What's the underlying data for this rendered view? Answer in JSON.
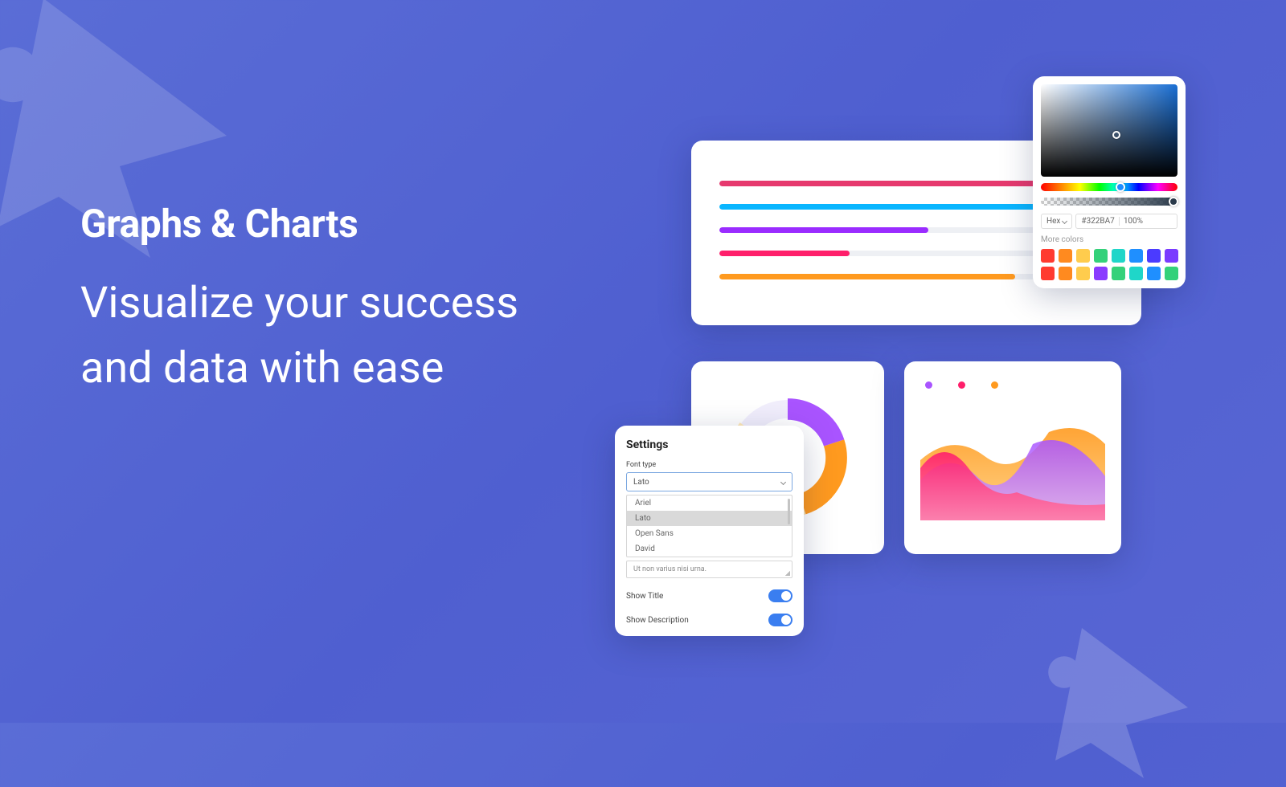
{
  "hero": {
    "title": "Graphs & Charts",
    "subtitle": "Visualize your success and data with ease"
  },
  "bars": [
    {
      "color": "#e6396e",
      "pct": 96
    },
    {
      "color": "#0ab6ff",
      "pct": 98
    },
    {
      "color": "#9a2cff",
      "pct": 53
    },
    {
      "color": "#ff1f6b",
      "pct": 33
    },
    {
      "color": "#ff9a1f",
      "pct": 75
    }
  ],
  "donut_colors": [
    "#a954ff",
    "#ffb81f",
    "#ffe9b8"
  ],
  "area_legend": [
    "#a954ff",
    "#ff1f6b",
    "#ff9a1f"
  ],
  "settings": {
    "title": "Settings",
    "font_label": "Font type",
    "font_selected": "Lato",
    "font_options": [
      "Ariel",
      "Lato",
      "Open Sans",
      "David"
    ],
    "textarea_value": "Ut non varius nisi urna.",
    "show_title_label": "Show Title",
    "show_desc_label": "Show Description",
    "show_title": true,
    "show_desc": true
  },
  "picker": {
    "mode": "Hex",
    "hex": "#322BA7",
    "alpha": "100%",
    "more_label": "More colors",
    "swatches": [
      "#ff3b30",
      "#ff8a1f",
      "#ffcc4d",
      "#34d17a",
      "#1fd6c9",
      "#1f8fff",
      "#4b3bff",
      "#7a3bff",
      "#ff3b30",
      "#ff8a1f",
      "#ffcc4d",
      "#8a3bff",
      "#34d17a",
      "#1fd6c9",
      "#1f8fff",
      "#34d17a"
    ]
  }
}
